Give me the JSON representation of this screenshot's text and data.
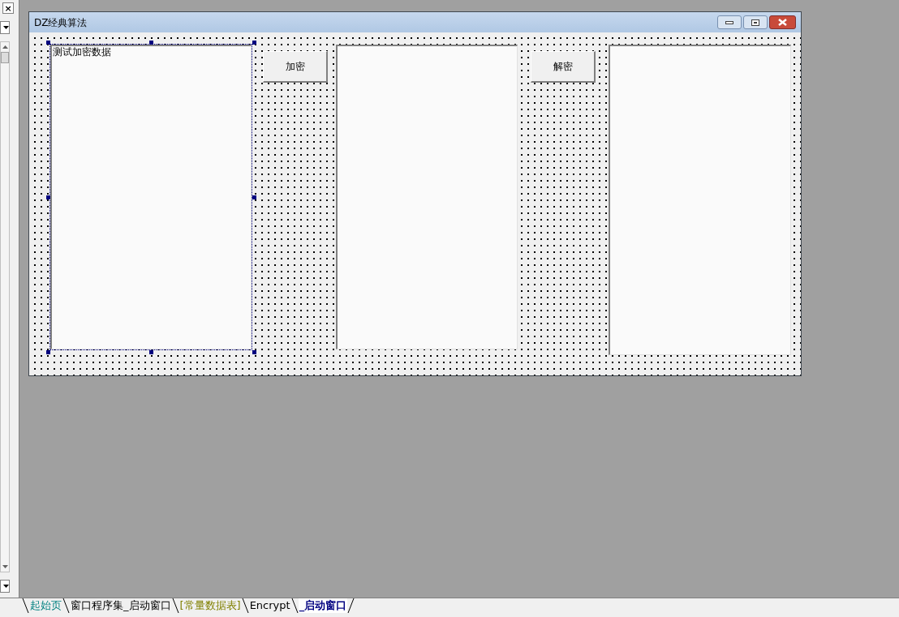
{
  "side_panel": {
    "close_glyph": "×"
  },
  "form": {
    "title": "DZ经典算法",
    "controls": [
      {
        "kind": "textbox",
        "text": "测试加密数据",
        "selected": true
      },
      {
        "kind": "button",
        "text": "加密"
      },
      {
        "kind": "textbox",
        "selected": false
      },
      {
        "kind": "button",
        "text": "解密"
      },
      {
        "kind": "textbox",
        "selected": false
      }
    ]
  },
  "tabs": [
    {
      "label": "起始页",
      "color": "#008080",
      "selected": false
    },
    {
      "label": "窗口程序集_启动窗口",
      "color": "#000000",
      "selected": false
    },
    {
      "label": "[常量数据表]",
      "color": "#808000",
      "selected": false
    },
    {
      "label": "Encrypt",
      "color": "#000000",
      "selected": false
    },
    {
      "label": "_启动窗口",
      "color": "#000080",
      "selected": true
    }
  ]
}
